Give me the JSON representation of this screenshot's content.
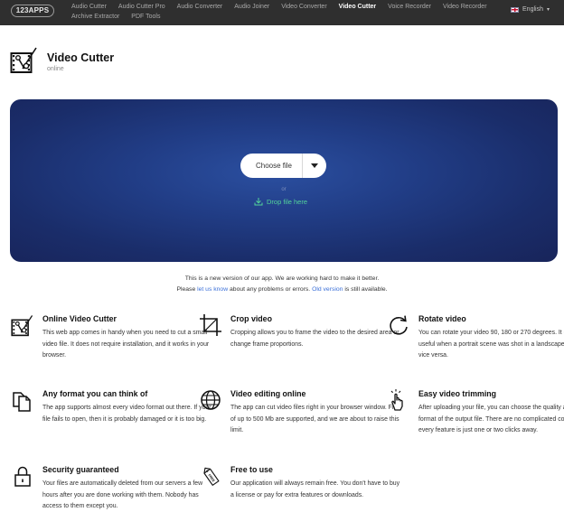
{
  "nav": {
    "logo": "123APPS",
    "items": [
      "Audio Cutter",
      "Audio Cutter Pro",
      "Audio Converter",
      "Audio Joiner",
      "Video Converter",
      "Video Cutter",
      "Voice Recorder",
      "Video Recorder",
      "Archive Extractor",
      "PDF Tools"
    ],
    "active": "Video Cutter",
    "language": "English"
  },
  "app": {
    "title": "Video Cutter",
    "subtitle": "online",
    "icon": "film-scissors-icon"
  },
  "upload": {
    "choose_label": "Choose file",
    "or_label": "or",
    "drop_label": "Drop file here",
    "accent": "#53d39a",
    "background": "#1f3a80"
  },
  "notice": {
    "line1": "This is a new version of our app. We are working hard to make it better.",
    "please": "Please ",
    "let_us_know": "let us know",
    "middle": " about any problems or errors. ",
    "old_version": "Old version",
    "end": " is still available."
  },
  "features": [
    {
      "icon": "film-scissors-icon",
      "title": "Online Video Cutter",
      "text": "This web app comes in handy when you need to cut a small video file. It does not require installation, and it works in your browser."
    },
    {
      "icon": "crop-icon",
      "title": "Crop video",
      "text": "Cropping allows you to frame the video to the desired area or change frame proportions."
    },
    {
      "icon": "rotate-icon",
      "title": "Rotate video",
      "text": "You can rotate your video 90, 180 or 270 degrees. It can be useful when a portrait scene was shot in a landscape mode or vice versa."
    },
    {
      "icon": "documents-icon",
      "title": "Any format you can think of",
      "text": "The app supports almost every video format out there. If your file fails to open, then it is probably damaged or it is too big."
    },
    {
      "icon": "globe-icon",
      "title": "Video editing online",
      "text": "The app can cut video files right in your browser window. Files of up to 500 Mb are supported, and we are about to raise this limit."
    },
    {
      "icon": "tap-hand-icon",
      "title": "Easy video trimming",
      "text": "After uploading your file, you can choose the quality and format of the output file. There are no complicated controls — every feature is just one or two clicks away."
    },
    {
      "icon": "lock-icon",
      "title": "Security guaranteed",
      "text": "Your files are automatically deleted from our servers a few hours after you are done working with them. Nobody has access to them except you."
    },
    {
      "icon": "free-tag-icon",
      "title": "Free to use",
      "text": "Our application will always remain free. You don't have to buy a license or pay for extra features or downloads."
    },
    {
      "tag_text": "FREE"
    }
  ]
}
